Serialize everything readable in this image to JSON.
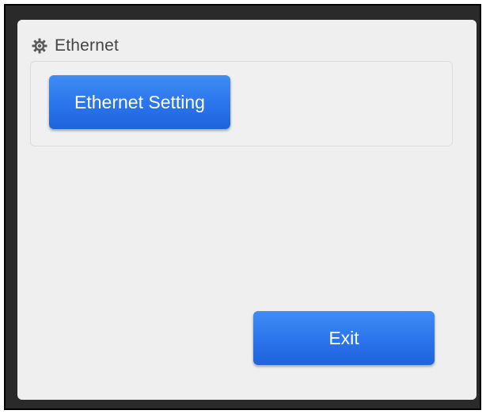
{
  "section": {
    "icon": "gear-icon",
    "title": "Ethernet"
  },
  "buttons": {
    "ethernet_setting_label": "Ethernet Setting",
    "exit_label": "Exit"
  },
  "colors": {
    "button_accent": "#2a74ec",
    "panel_background": "#efefef",
    "frame_background": "#2a2a2a"
  }
}
